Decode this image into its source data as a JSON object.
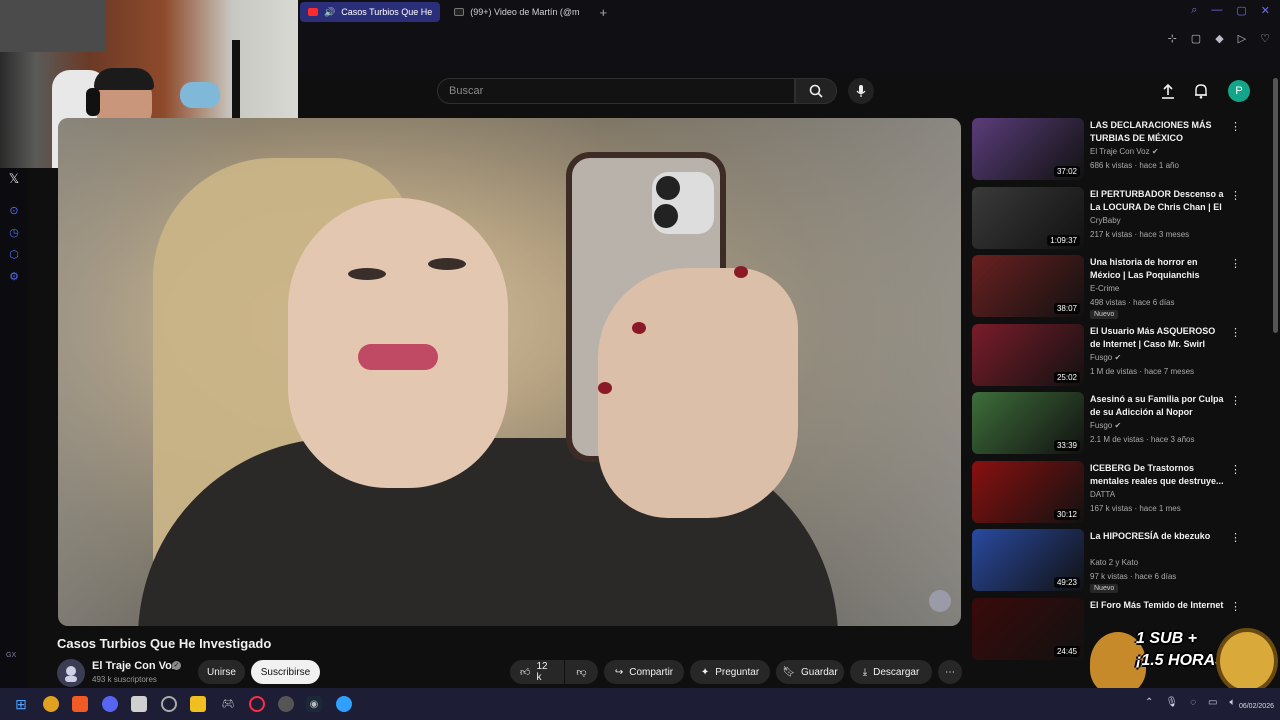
{
  "browser": {
    "tabs": [
      {
        "label": "Casos Turbios Que He",
        "active": true
      },
      {
        "label": "(99+) Video de Martín (@m",
        "active": false
      }
    ],
    "new_tab": "+"
  },
  "search": {
    "placeholder": "Buscar"
  },
  "account": {
    "initial": "P",
    "color": "#12a58a"
  },
  "video": {
    "title": "Casos Turbios Que He Investigado",
    "channel": "El Traje Con Voz",
    "subscribers": "493 k suscriptores",
    "join_label": "Unirse",
    "subscribe_label": "Suscribirse",
    "likes": "12 k",
    "share_label": "Compartir",
    "ask_label": "Preguntar",
    "save_label": "Guardar",
    "download_label": "Descargar"
  },
  "recommendations": [
    {
      "title": "LAS DECLARACIONES MÁS TURBIAS DE MÉXICO",
      "channel": "El Traje Con Voz",
      "verified": true,
      "meta": "686 k vistas · hace 1 año",
      "duration": "37:02",
      "badge": "",
      "thumb_color": "#5a3d7a"
    },
    {
      "title": "El PERTURBADOR Descenso a La LOCURA De Chris Chan | El ...",
      "channel": "CryBaby",
      "verified": false,
      "meta": "217 k vistas · hace 3 meses",
      "duration": "1:09:37",
      "badge": "",
      "thumb_color": "#3a3a3a"
    },
    {
      "title": "Una historia de horror en México | Las Poquianchis",
      "channel": "E-Crime",
      "verified": false,
      "meta": "498 vistas · hace 6 días",
      "duration": "38:07",
      "badge": "Nuevo",
      "thumb_color": "#6b2020"
    },
    {
      "title": "El Usuario Más ASQUEROSO de Internet | Caso Mr. Swirl",
      "channel": "Fusgo",
      "verified": true,
      "meta": "1 M de vistas · hace 7 meses",
      "duration": "25:02",
      "badge": "",
      "thumb_color": "#7a1c2a"
    },
    {
      "title": "Asesinó a su Familia por Culpa de su Adicción al Nopor",
      "channel": "Fusgo",
      "verified": true,
      "meta": "2.1 M de vistas · hace 3 años",
      "duration": "33:39",
      "badge": "",
      "thumb_color": "#3e6e3a"
    },
    {
      "title": "ICEBERG De Trastornos mentales reales que destruye...",
      "channel": "DATTA",
      "verified": false,
      "meta": "167 k vistas · hace 1 mes",
      "duration": "30:12",
      "badge": "",
      "thumb_color": "#8a1010"
    },
    {
      "title": "La HIPOCRESÍA de kbezuko",
      "channel": "Kato 2 y Kato",
      "verified": false,
      "meta": "97 k vistas · hace 6 días",
      "duration": "49:23",
      "badge": "Nuevo",
      "thumb_color": "#2a4aa0"
    },
    {
      "title": "El Foro Más Temido de Internet",
      "channel": "",
      "verified": false,
      "meta": "",
      "duration": "24:45",
      "badge": "",
      "thumb_color": "#3a0a0a"
    }
  ],
  "overlay": {
    "line1": "1 SUB +",
    "line2": "¡1.5 HORAS!"
  },
  "sidebar_label": "GX",
  "taskbar": {
    "date": "06/02/2026"
  }
}
